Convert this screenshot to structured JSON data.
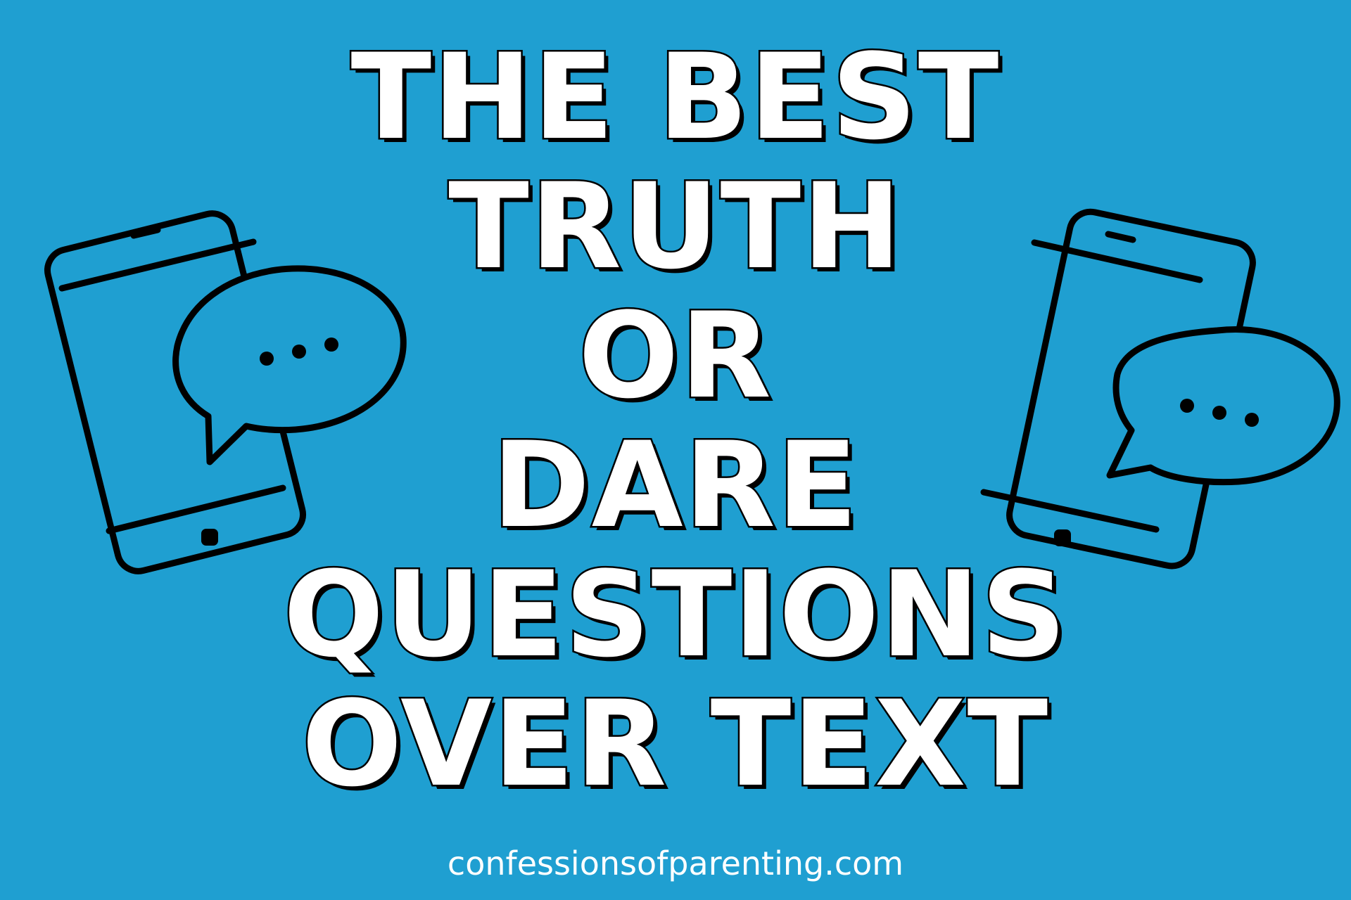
{
  "title": {
    "lines": [
      "THE BEST",
      "TRUTH",
      "OR",
      "DARE",
      "QUESTIONS",
      "OVER TEXT"
    ]
  },
  "footer": {
    "site": "confessionsofparenting.com"
  },
  "colors": {
    "background": "#1f9fd1",
    "text_fill": "#ffffff",
    "outline": "#000000"
  },
  "icons": {
    "left": "smartphone-chat-bubble-icon",
    "right": "smartphone-chat-bubble-icon"
  }
}
